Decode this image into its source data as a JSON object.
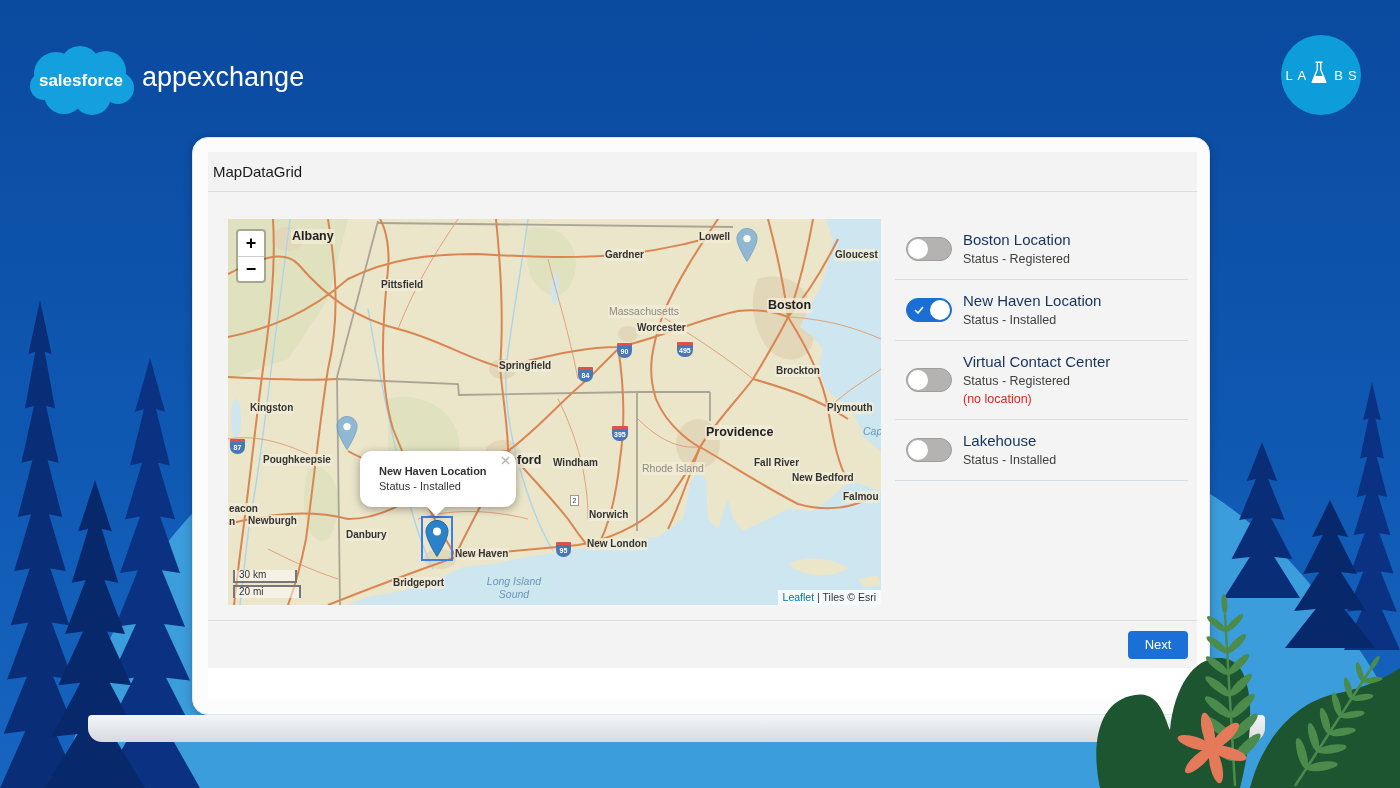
{
  "brand": {
    "cloud_text": "salesforce",
    "product": "appexchange"
  },
  "labs_logo": {
    "left_text": "LA",
    "right_text": "BS"
  },
  "app": {
    "title": "MapDataGrid"
  },
  "map": {
    "zoom_controls": [
      "+",
      "−"
    ],
    "labels": [
      {
        "text": "Albany",
        "kind": "major"
      },
      {
        "text": "Gardner",
        "kind": "city"
      },
      {
        "text": "Lowell",
        "kind": "city"
      },
      {
        "text": "Gloucest",
        "kind": "city"
      },
      {
        "text": "Pittsfield",
        "kind": "city"
      },
      {
        "text": "Massachusetts",
        "kind": "region"
      },
      {
        "text": "Worcester",
        "kind": "city"
      },
      {
        "text": "Boston",
        "kind": "major"
      },
      {
        "text": "Springfield",
        "kind": "city"
      },
      {
        "text": "Brockton",
        "kind": "city"
      },
      {
        "text": "Kingston",
        "kind": "city"
      },
      {
        "text": "Plymouth",
        "kind": "city"
      },
      {
        "text": "Providence",
        "kind": "major"
      },
      {
        "text": "Cap",
        "kind": "water"
      },
      {
        "text": "Poughkeepsie",
        "kind": "city"
      },
      {
        "text": "ford",
        "kind": "major"
      },
      {
        "text": "Windham",
        "kind": "city"
      },
      {
        "text": "Rhode Island",
        "kind": "region"
      },
      {
        "text": "Fall River",
        "kind": "city"
      },
      {
        "text": "New Bedford",
        "kind": "city"
      },
      {
        "text": "Falmou",
        "kind": "city"
      },
      {
        "text": "eacon",
        "kind": "city"
      },
      {
        "text": "n",
        "kind": "city"
      },
      {
        "text": "Newburgh",
        "kind": "city"
      },
      {
        "text": "Norwich",
        "kind": "city"
      },
      {
        "text": "Danbury",
        "kind": "city"
      },
      {
        "text": "New Haven",
        "kind": "city"
      },
      {
        "text": "New London",
        "kind": "city"
      },
      {
        "text": "Bridgeport",
        "kind": "city"
      },
      {
        "text": "Long Island Sound",
        "kind": "water"
      }
    ],
    "route_signs": [
      {
        "label": "90",
        "kind": "interstate"
      },
      {
        "label": "495",
        "kind": "interstate"
      },
      {
        "label": "84",
        "kind": "interstate"
      },
      {
        "label": "395",
        "kind": "interstate"
      },
      {
        "label": "87",
        "kind": "interstate"
      },
      {
        "label": "2",
        "kind": "state"
      },
      {
        "label": "95",
        "kind": "interstate"
      }
    ],
    "markers": [
      {
        "selected": false
      },
      {
        "selected": false
      },
      {
        "selected": true
      }
    ],
    "popup": {
      "title": "New Haven Location",
      "text": "Status - Installed"
    },
    "scale": [
      "30 km",
      "20 mi"
    ],
    "attribution": {
      "link": "Leaflet",
      "text": "| Tiles © Esri"
    }
  },
  "locations": [
    {
      "name": "Boston Location",
      "status": "Status - Registered",
      "on": false
    },
    {
      "name": "New Haven Location",
      "status": "Status - Installed",
      "on": true
    },
    {
      "name": "Virtual Contact Center",
      "status": "Status - Registered",
      "note": "(no location)",
      "on": false
    },
    {
      "name": "Lakehouse",
      "status": "Status - Installed",
      "on": false
    }
  ],
  "footer": {
    "button": "Next"
  }
}
